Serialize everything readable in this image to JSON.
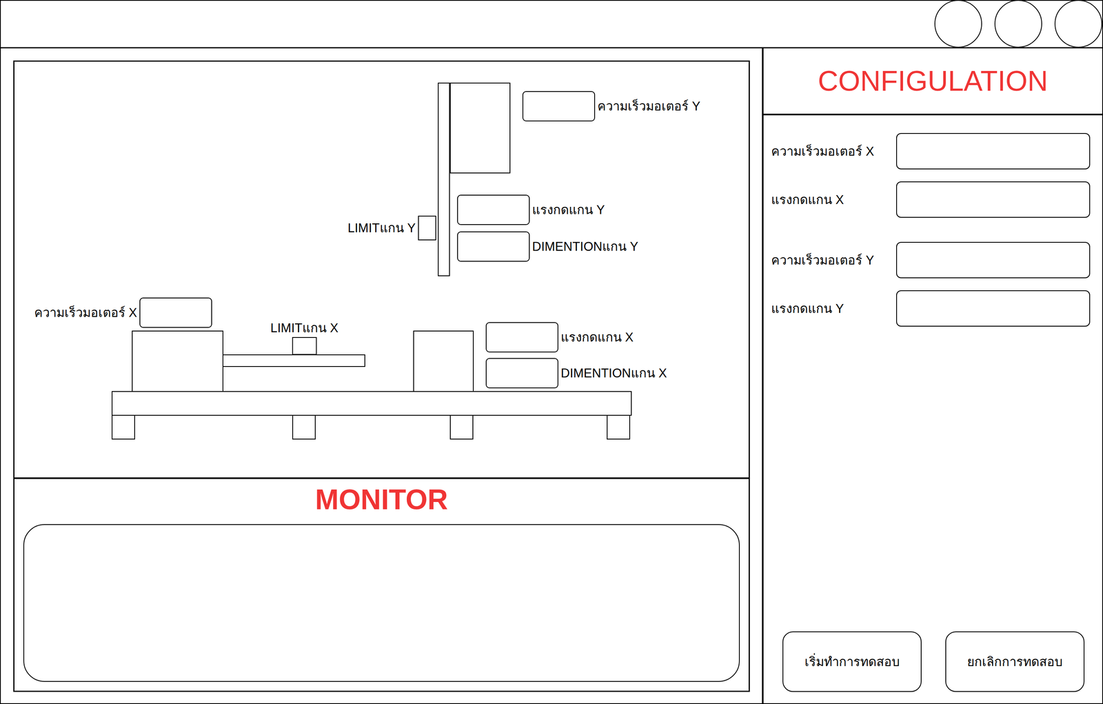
{
  "diagram": {
    "axis_y": {
      "motor_speed": "ความเร็วมอเตอร์ Y",
      "force": "แรงกดแกน Y",
      "dimension": "DIMENTIONแกน Y",
      "limit": "LIMITแกน Y"
    },
    "axis_x": {
      "motor_speed": "ความเร็วมอเตอร์ X",
      "force": "แรงกดแกน X",
      "dimension": "DIMENTIONแกน X",
      "limit": "LIMITแกน X"
    }
  },
  "monitor": {
    "title": "MONITOR",
    "log": ""
  },
  "configuration": {
    "title": "CONFIGULATION",
    "groups": [
      {
        "fields": [
          {
            "label": "ความเร็วมอเตอร์ X",
            "value": ""
          },
          {
            "label": "แรงกดแกน X",
            "value": ""
          }
        ]
      },
      {
        "fields": [
          {
            "label": "ความเร็วมอเตอร์ Y",
            "value": ""
          },
          {
            "label": "แรงกดแกน Y",
            "value": ""
          }
        ]
      }
    ]
  },
  "buttons": [
    {
      "label": "เริ่มทำการทดสอบ"
    },
    {
      "label": "ยกเลิกการทดสอบ"
    }
  ]
}
